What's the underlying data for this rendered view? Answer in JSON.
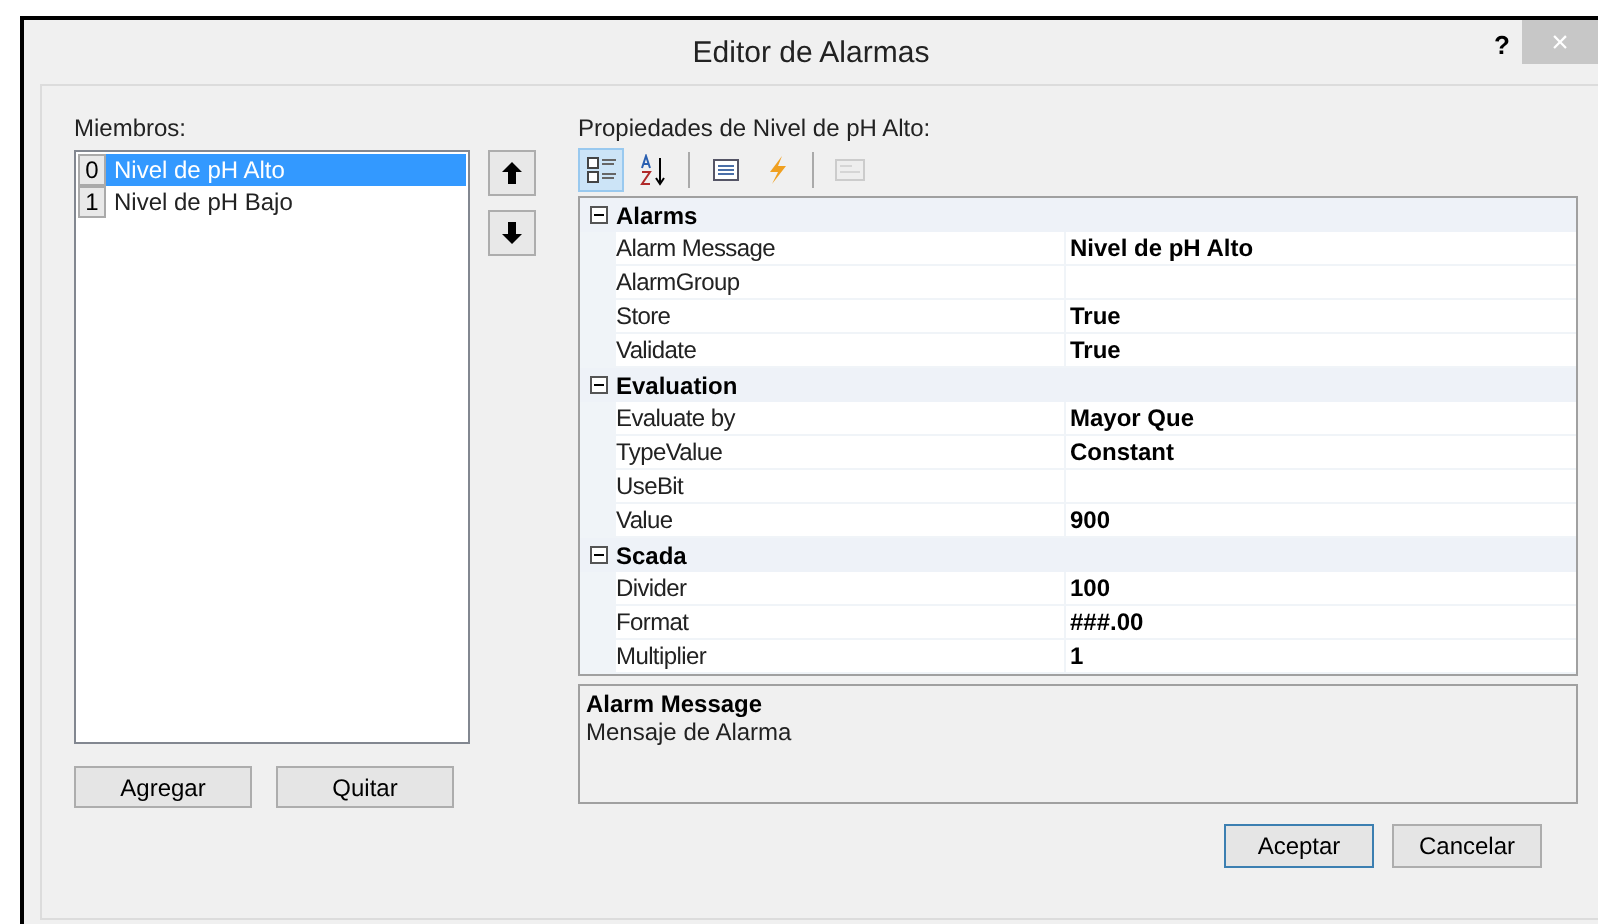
{
  "window": {
    "title": "Editor de Alarmas",
    "help": "?",
    "close": "×"
  },
  "members": {
    "label": "Miembros:",
    "items": [
      {
        "index": "0",
        "name": "Nivel de pH Alto",
        "selected": true
      },
      {
        "index": "1",
        "name": "Nivel de pH Bajo",
        "selected": false
      }
    ]
  },
  "properties": {
    "label": "Propiedades de Nivel de pH Alto:",
    "toolbar": [
      {
        "kind": "categorized",
        "selected": true,
        "disabled": false
      },
      {
        "kind": "alphabetical",
        "selected": false,
        "disabled": false
      },
      {
        "kind": "separator"
      },
      {
        "kind": "properties",
        "selected": false,
        "disabled": false
      },
      {
        "kind": "events",
        "selected": false,
        "disabled": false
      },
      {
        "kind": "separator"
      },
      {
        "kind": "pages",
        "selected": false,
        "disabled": true
      }
    ],
    "categories": [
      {
        "name": "Alarms",
        "expanded": true,
        "rows": [
          {
            "name": "Alarm Message",
            "value": "Nivel de pH Alto"
          },
          {
            "name": "AlarmGroup"
          },
          {
            "name": "Store",
            "value": "True"
          },
          {
            "name": "Validate",
            "value": "True"
          }
        ]
      },
      {
        "name": "Evaluation",
        "expanded": true,
        "rows": [
          {
            "name": "Evaluate by",
            "value": "Mayor Que"
          },
          {
            "name": "TypeValue",
            "value": "Constant"
          },
          {
            "name": "UseBit"
          },
          {
            "name": "Value",
            "value": "900"
          }
        ]
      },
      {
        "name": "Scada",
        "expanded": true,
        "rows": [
          {
            "name": "Divider",
            "value": "100"
          },
          {
            "name": "Format",
            "value": "###.00"
          },
          {
            "name": "Multiplier",
            "value": "1"
          }
        ]
      }
    ],
    "description": {
      "title": "Alarm Message",
      "text": "Mensaje de Alarma"
    }
  },
  "member_buttons": [
    "Agregar",
    "Quitar"
  ],
  "dialog_buttons": [
    {
      "label": "Aceptar",
      "default": true
    },
    {
      "label": "Cancelar",
      "default": false
    }
  ]
}
